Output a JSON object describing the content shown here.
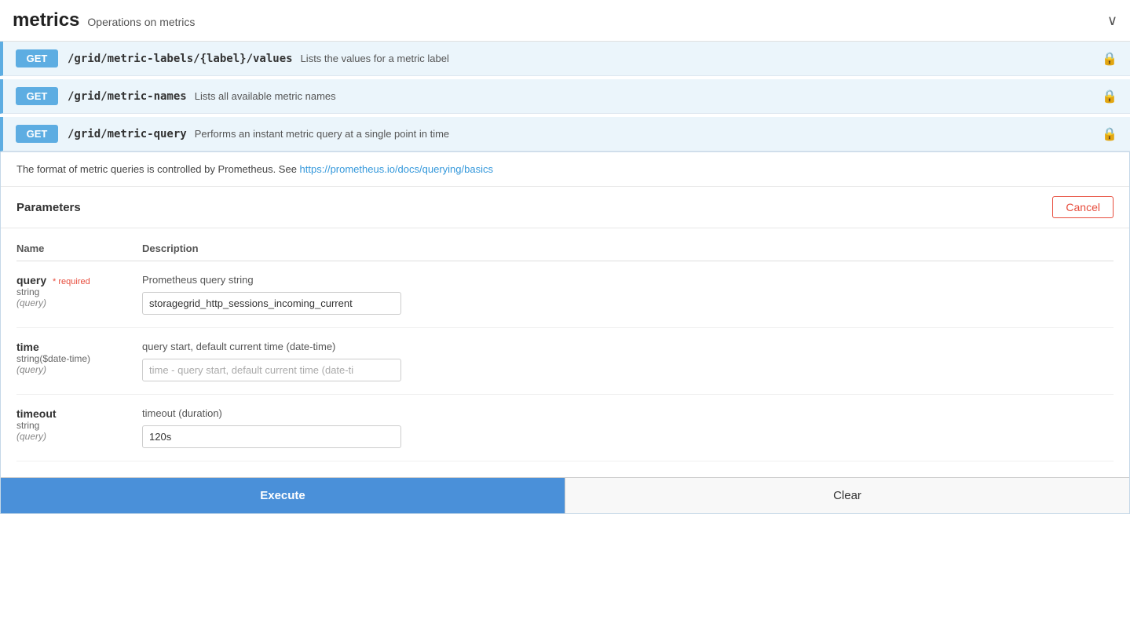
{
  "header": {
    "title": "metrics",
    "subtitle": "Operations on metrics"
  },
  "endpoints": [
    {
      "method": "GET",
      "path": "/grid/metric-labels/{label}/values",
      "description": "Lists the values for a metric label"
    },
    {
      "method": "GET",
      "path": "/grid/metric-names",
      "description": "Lists all available metric names"
    },
    {
      "method": "GET",
      "path": "/grid/metric-query",
      "description": "Performs an instant metric query at a single point in time"
    }
  ],
  "expanded": {
    "info": "The format of metric queries is controlled by Prometheus. See ",
    "info_link_text": "https://prometheus.io/docs/querying/basics",
    "info_link_href": "https://prometheus.io/docs/querying/basics",
    "params_label": "Parameters",
    "cancel_label": "Cancel",
    "columns": {
      "name": "Name",
      "description": "Description"
    },
    "parameters": [
      {
        "name": "query",
        "required": true,
        "required_label": "* required",
        "type": "string",
        "location": "(query)",
        "description": "Prometheus query string",
        "input_value": "storagegrid_http_sessions_incoming_current",
        "input_placeholder": "Prometheus query string"
      },
      {
        "name": "time",
        "required": false,
        "required_label": "",
        "type": "string($date-time)",
        "location": "(query)",
        "description": "query start, default current time (date-time)",
        "input_value": "",
        "input_placeholder": "time - query start, default current time (date-ti"
      },
      {
        "name": "timeout",
        "required": false,
        "required_label": "",
        "type": "string",
        "location": "(query)",
        "description": "timeout (duration)",
        "input_value": "120s",
        "input_placeholder": "timeout (duration)"
      }
    ],
    "execute_label": "Execute",
    "clear_label": "Clear"
  },
  "icons": {
    "lock": "🔒",
    "chevron_down": "∨"
  }
}
